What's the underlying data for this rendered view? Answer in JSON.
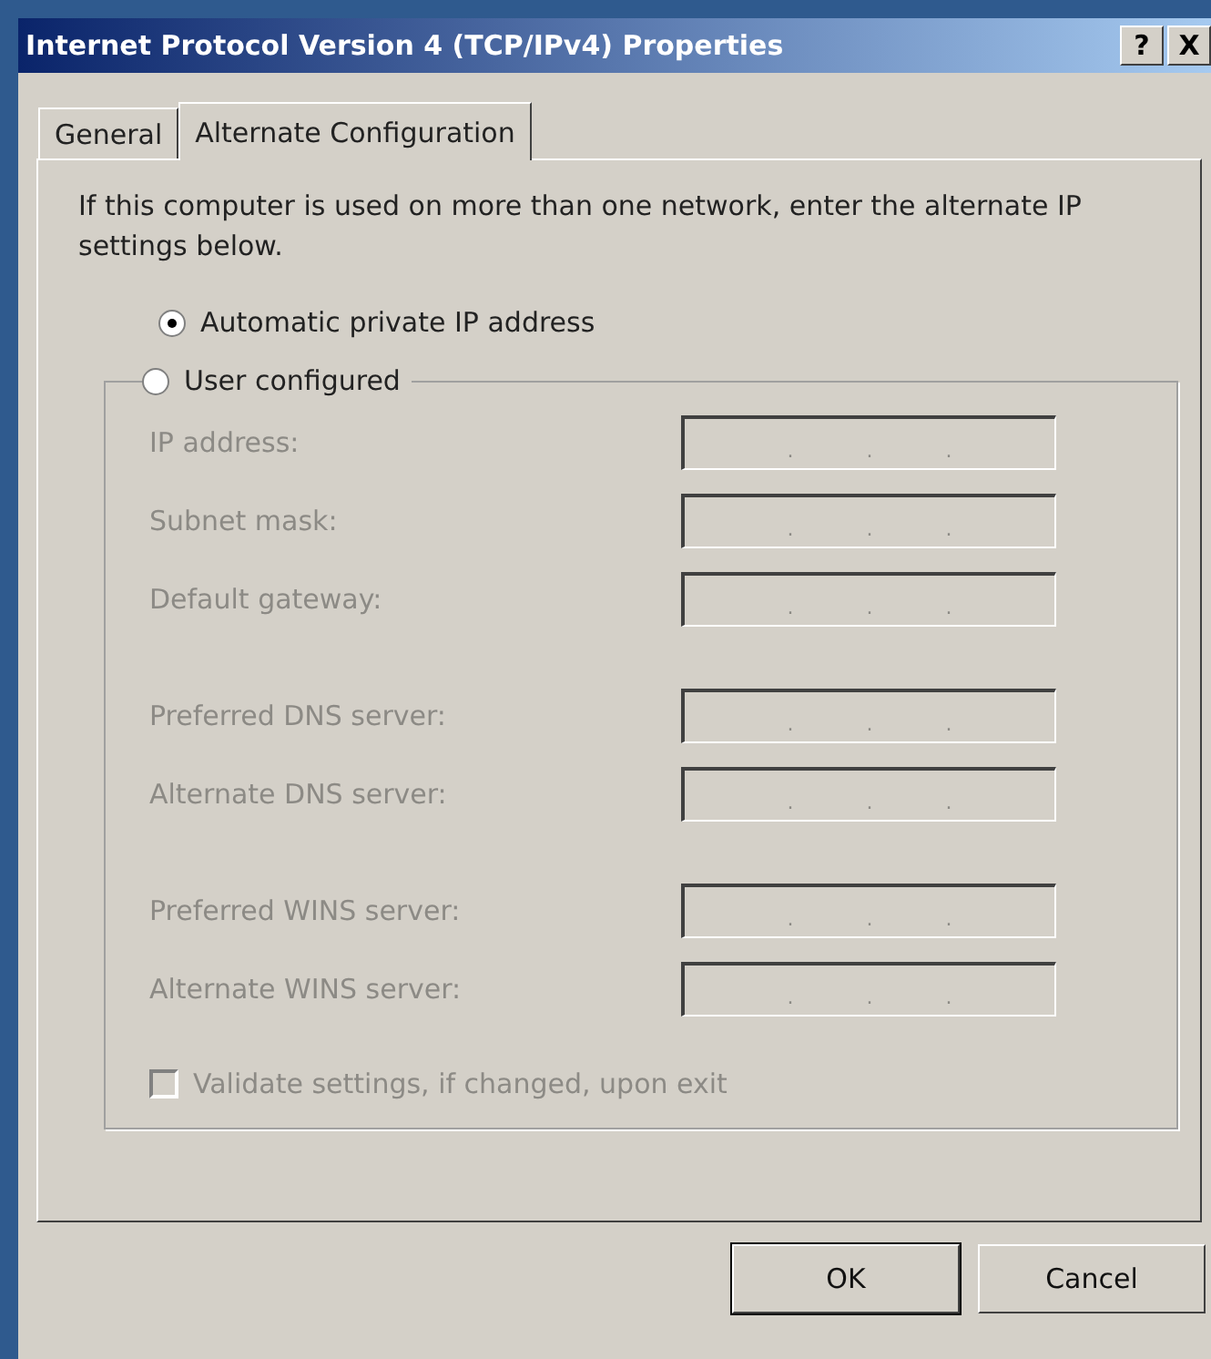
{
  "window": {
    "title": "Internet Protocol Version 4 (TCP/IPv4) Properties",
    "buttons": [
      "?",
      "X"
    ]
  },
  "tabs": [
    {
      "label": "General",
      "selected": false
    },
    {
      "label": "Alternate Configuration",
      "selected": true
    }
  ],
  "intro": "If this computer is used on more than one network, enter the alternate IP settings below.",
  "modes": [
    {
      "label": "Automatic private IP address",
      "selected": true
    },
    {
      "label": "User configured",
      "selected": false
    }
  ],
  "field_groups": [
    [
      {
        "label": "IP address:",
        "disabled": true,
        "separators": [
          ".",
          ".",
          "."
        ]
      },
      {
        "label": "Subnet mask:",
        "disabled": true,
        "separators": [
          ".",
          ".",
          "."
        ]
      },
      {
        "label": "Default gateway:",
        "disabled": true,
        "separators": [
          ".",
          ".",
          "."
        ]
      }
    ],
    [
      {
        "label": "Preferred DNS server:",
        "disabled": true,
        "separators": [
          ".",
          ".",
          "."
        ]
      },
      {
        "label": "Alternate DNS server:",
        "disabled": true,
        "separators": [
          ".",
          ".",
          "."
        ]
      }
    ],
    [
      {
        "label": "Preferred WINS server:",
        "disabled": true,
        "separators": [
          ".",
          ".",
          "."
        ]
      },
      {
        "label": "Alternate WINS server:",
        "disabled": true,
        "separators": [
          ".",
          ".",
          "."
        ]
      }
    ]
  ],
  "validate": {
    "label": "Validate settings, if changed, upon exit",
    "checked": false,
    "disabled": true
  },
  "buttons": [
    {
      "label": "OK",
      "default": true
    },
    {
      "label": "Cancel",
      "default": false
    }
  ]
}
